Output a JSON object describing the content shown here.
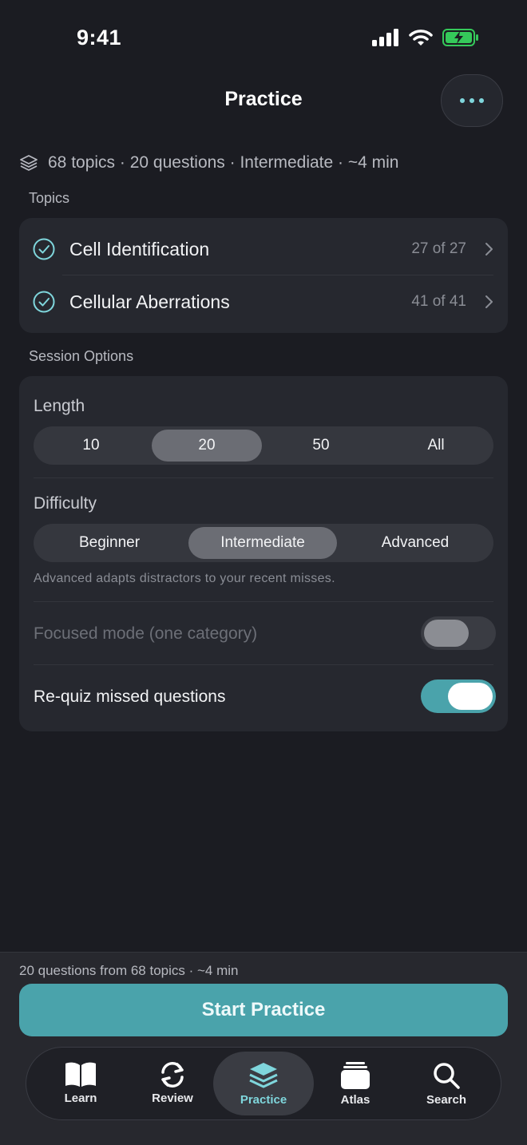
{
  "status_bar": {
    "time": "9:41"
  },
  "nav": {
    "title": "Practice"
  },
  "summary": {
    "text": "68 topics · 20 questions · Intermediate · ~4 min"
  },
  "topics": {
    "section_label": "Topics",
    "items": [
      {
        "name": "Cell Identification",
        "count": "27 of 27"
      },
      {
        "name": "Cellular Aberrations",
        "count": "41 of 41"
      }
    ]
  },
  "session_options": {
    "section_label": "Session Options",
    "length": {
      "label": "Length",
      "options": [
        "10",
        "20",
        "50",
        "All"
      ],
      "selected": "20"
    },
    "difficulty": {
      "label": "Difficulty",
      "options": [
        "Beginner",
        "Intermediate",
        "Advanced"
      ],
      "selected": "Intermediate",
      "hint": "Advanced adapts distractors to your recent misses."
    },
    "focused_mode": {
      "label": "Focused mode (one category)",
      "enabled": false,
      "disabled": true
    },
    "requiz": {
      "label": "Re-quiz missed questions",
      "enabled": true
    }
  },
  "footer": {
    "summary": "20 questions from 68 topics · ~4 min",
    "start_label": "Start Practice"
  },
  "tab_bar": {
    "active": "Practice",
    "items": [
      {
        "label": "Learn",
        "icon": "book-icon"
      },
      {
        "label": "Review",
        "icon": "refresh-icon"
      },
      {
        "label": "Practice",
        "icon": "layers-icon"
      },
      {
        "label": "Atlas",
        "icon": "stack-icon"
      },
      {
        "label": "Search",
        "icon": "search-icon"
      }
    ]
  },
  "colors": {
    "background": "#1b1c22",
    "card": "#26282f",
    "accent": "#4aa3ab",
    "accent_light": "#7fd6dc",
    "battery": "#35c95a"
  }
}
